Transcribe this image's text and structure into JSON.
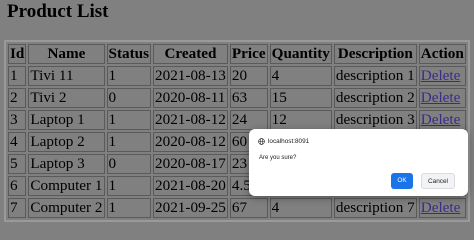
{
  "page": {
    "title": "Product List"
  },
  "table": {
    "headers": [
      "Id",
      "Name",
      "Status",
      "Created",
      "Price",
      "Quantity",
      "Description",
      "Action"
    ],
    "rows": [
      {
        "id": "1",
        "name": "Tivi 11",
        "status": "1",
        "created": "2021-08-13",
        "price": "20",
        "quantity": "4",
        "description": "description 1",
        "action": "Delete"
      },
      {
        "id": "2",
        "name": "Tivi 2",
        "status": "0",
        "created": "2020-08-11",
        "price": "63",
        "quantity": "15",
        "description": "description 2",
        "action": "Delete"
      },
      {
        "id": "3",
        "name": "Laptop 1",
        "status": "1",
        "created": "2021-08-12",
        "price": "24",
        "quantity": "12",
        "description": "description 3",
        "action": "Delete"
      },
      {
        "id": "4",
        "name": "Laptop 2",
        "status": "1",
        "created": "2020-08-12",
        "price": "60",
        "quantity": "",
        "description": "",
        "action": ""
      },
      {
        "id": "5",
        "name": "Laptop 3",
        "status": "0",
        "created": "2020-08-17",
        "price": "23",
        "quantity": "",
        "description": "",
        "action": ""
      },
      {
        "id": "6",
        "name": "Computer 1",
        "status": "1",
        "created": "2021-08-20",
        "price": "4.5",
        "quantity": "",
        "description": "",
        "action": ""
      },
      {
        "id": "7",
        "name": "Computer 2",
        "status": "1",
        "created": "2021-09-25",
        "price": "67",
        "quantity": "4",
        "description": "description 7",
        "action": "Delete"
      }
    ]
  },
  "dialog": {
    "origin": "localhost:8091",
    "message": "Are you sure?",
    "ok_label": "OK",
    "cancel_label": "Cancel",
    "icon": "globe-icon"
  },
  "colors": {
    "page_background": "#808080",
    "link": "#3d2a8a",
    "ok_button": "#1a73e8"
  }
}
